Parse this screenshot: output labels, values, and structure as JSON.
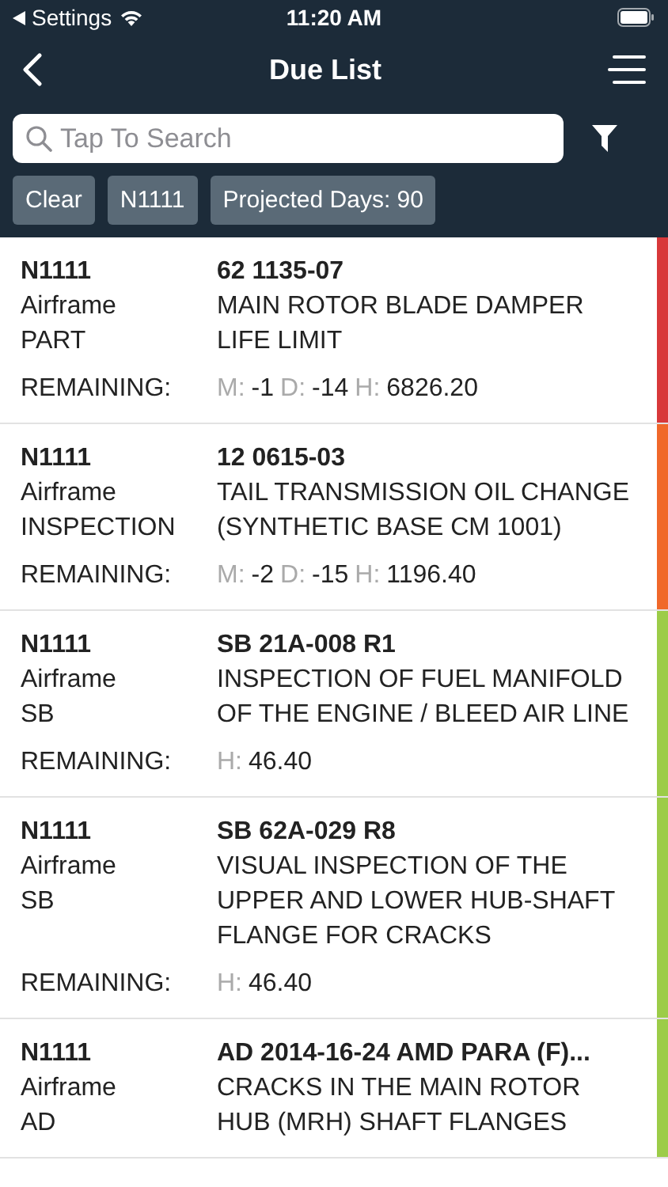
{
  "status_bar": {
    "back_label": "Settings",
    "time": "11:20 AM"
  },
  "nav": {
    "title": "Due List"
  },
  "search": {
    "placeholder": "Tap To Search"
  },
  "filters": [
    {
      "label": "Clear"
    },
    {
      "label": "N1111"
    },
    {
      "label": "Projected Days: 90"
    }
  ],
  "items": [
    {
      "tail": "N1111",
      "group": "Airframe",
      "type": "PART",
      "code": "62 1135-07",
      "description": "MAIN ROTOR BLADE DAMPER LIFE LIMIT",
      "remaining_label": "REMAINING:",
      "remaining": [
        {
          "unit": "M:",
          "value": "-1"
        },
        {
          "unit": "D:",
          "value": "-14"
        },
        {
          "unit": "H:",
          "value": "6826.20"
        }
      ],
      "color": "#d8383a"
    },
    {
      "tail": "N1111",
      "group": "Airframe",
      "type": "INSPECTION",
      "code": "12 0615-03",
      "description": "TAIL TRANSMISSION OIL CHANGE (SYNTHETIC BASE CM 1001)",
      "remaining_label": "REMAINING:",
      "remaining": [
        {
          "unit": "M:",
          "value": "-2"
        },
        {
          "unit": "D:",
          "value": "-15"
        },
        {
          "unit": "H:",
          "value": "1196.40"
        }
      ],
      "color": "#f0682a"
    },
    {
      "tail": "N1111",
      "group": "Airframe",
      "type": "SB",
      "code": "SB 21A-008 R1",
      "description": "INSPECTION OF FUEL MANIFOLD OF THE ENGINE / BLEED AIR LINE",
      "remaining_label": "REMAINING:",
      "remaining": [
        {
          "unit": "H:",
          "value": "46.40"
        }
      ],
      "color": "#9ccc48"
    },
    {
      "tail": "N1111",
      "group": "Airframe",
      "type": "SB",
      "code": "SB 62A-029 R8",
      "description": "VISUAL INSPECTION OF THE UPPER AND LOWER HUB-SHAFT FLANGE FOR CRACKS",
      "remaining_label": "REMAINING:",
      "remaining": [
        {
          "unit": "H:",
          "value": "46.40"
        }
      ],
      "color": "#9ccc48"
    },
    {
      "tail": "N1111",
      "group": "Airframe",
      "type": "AD",
      "code": "AD 2014-16-24 AMD PARA (F)...",
      "description": "CRACKS IN THE MAIN ROTOR HUB (MRH) SHAFT FLANGES",
      "color": "#9ccc48"
    }
  ]
}
